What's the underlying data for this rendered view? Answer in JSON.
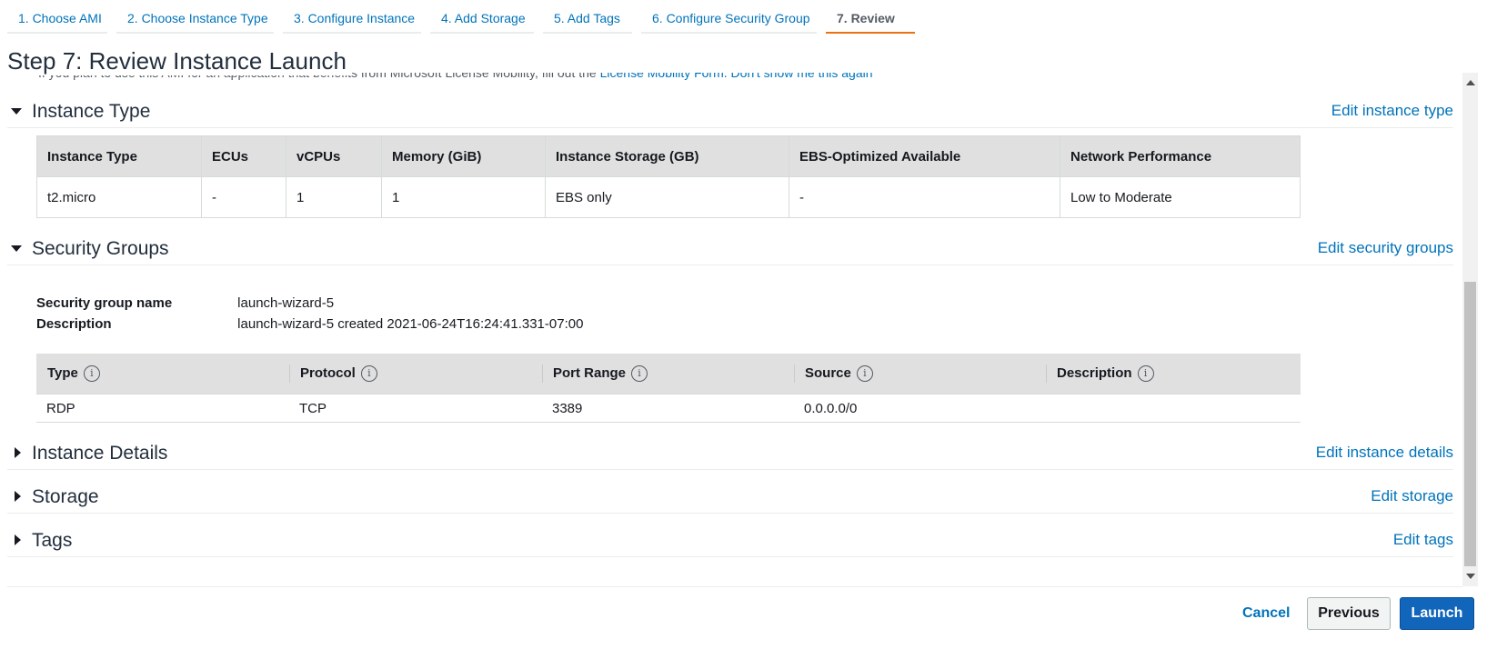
{
  "wizard": {
    "tabs": [
      {
        "label": "1. Choose AMI"
      },
      {
        "label": "2. Choose Instance Type"
      },
      {
        "label": "3. Configure Instance"
      },
      {
        "label": "4. Add Storage"
      },
      {
        "label": "5. Add Tags"
      },
      {
        "label": "6. Configure Security Group"
      },
      {
        "label": "7. Review"
      }
    ],
    "active_tab": "7. Review"
  },
  "page": {
    "title": "Step 7: Review Instance Launch",
    "cut_text": "If you plan to use this AMI for an application that benefits from Microsoft License Mobility, fill out the",
    "cut_link_1": "License Mobility Form.",
    "cut_link_2": "Don't show me this again"
  },
  "instance_type_section": {
    "title": "Instance Type",
    "edit_label": "Edit instance type",
    "columns": [
      "Instance Type",
      "ECUs",
      "vCPUs",
      "Memory (GiB)",
      "Instance Storage (GB)",
      "EBS-Optimized Available",
      "Network Performance"
    ],
    "row": [
      "t2.micro",
      "-",
      "1",
      "1",
      "EBS only",
      "-",
      "Low to Moderate"
    ]
  },
  "security_groups_section": {
    "title": "Security Groups",
    "edit_label": "Edit security groups",
    "name_label": "Security group name",
    "name_value": "launch-wizard-5",
    "description_label": "Description",
    "description_value": "launch-wizard-5 created 2021-06-24T16:24:41.331-07:00",
    "rule_columns": [
      "Type",
      "Protocol",
      "Port Range",
      "Source",
      "Description"
    ],
    "rules": [
      [
        "RDP",
        "TCP",
        "3389",
        "0.0.0.0/0",
        ""
      ]
    ]
  },
  "instance_details_section": {
    "title": "Instance Details",
    "edit_label": "Edit instance details"
  },
  "storage_section": {
    "title": "Storage",
    "edit_label": "Edit storage"
  },
  "tags_section": {
    "title": "Tags",
    "edit_label": "Edit tags"
  },
  "footer": {
    "cancel_label": "Cancel",
    "previous_label": "Previous",
    "launch_label": "Launch"
  },
  "colors": {
    "link": "#0073bb",
    "active_tab_underline": "#ec7211",
    "launch_button": "#1166bb"
  },
  "icons": {
    "info": "info-icon",
    "section_expanded": "caret-down-icon",
    "section_collapsed": "caret-right-icon"
  }
}
